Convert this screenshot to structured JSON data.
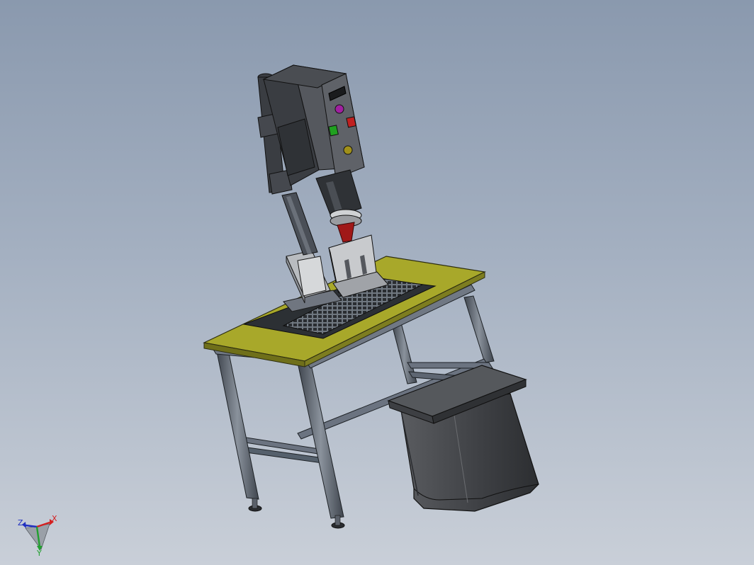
{
  "triad": {
    "x_label": "X",
    "y_label": "Y",
    "z_label": "Z",
    "x_color": "#d42020",
    "y_color": "#22a030",
    "z_color": "#2030c0"
  },
  "model": {
    "table_top_color": "#a8a82a",
    "frame_color": "#5c6470",
    "machine_color": "#3c3f44",
    "horn_color": "#a01818",
    "button_colors": [
      "#a020a0",
      "#20a020",
      "#c02020",
      "#a0901a"
    ],
    "stool_color": "#4a4c50"
  }
}
